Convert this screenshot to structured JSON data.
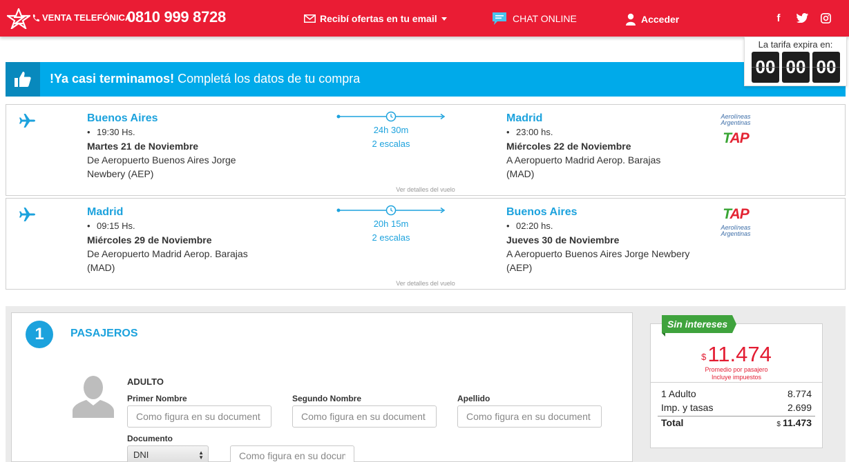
{
  "header": {
    "phone_label": "VENTA TELEFÓNICA",
    "phone_number": "0810 999 8728",
    "offers_label": "Recibí ofertas en tu email",
    "chat_label": "CHAT ONLINE",
    "login_label": "Acceder",
    "social_icons": [
      "facebook-icon",
      "twitter-icon",
      "instagram-icon"
    ],
    "brand_color": "#ea1c34"
  },
  "timer": {
    "label": "La tarifa expira en:",
    "hours": "00",
    "minutes": "00",
    "seconds": "00"
  },
  "banner": {
    "bold": "!Ya casi terminamos!",
    "text": " Completá los datos de tu compra",
    "color": "#00aaea"
  },
  "flights": [
    {
      "departure": {
        "city": "Buenos Aires",
        "time": "19:30 Hs.",
        "date": "Martes 21 de Noviembre",
        "airport": "De Aeropuerto Buenos Aires Jorge Newbery (AEP)"
      },
      "duration": "24h 30m",
      "stops": "2 escalas",
      "arrival": {
        "city": "Madrid",
        "time": "23:00 hs.",
        "date": "Miércoles 22 de Noviembre",
        "airport": "A Aeropuerto Madrid Aerop. Barajas (MAD)"
      },
      "details_link": "Ver detalles del vuelo",
      "airline_primary": "Aerolíneas Argentinas",
      "airline_secondary": "TAP"
    },
    {
      "departure": {
        "city": "Madrid",
        "time": "09:15 Hs.",
        "date": "Miércoles 29 de Noviembre",
        "airport": "De Aeropuerto Madrid Aerop. Barajas (MAD)"
      },
      "duration": "20h 15m",
      "stops": "2 escalas",
      "arrival": {
        "city": "Buenos Aires",
        "time": "02:20 hs.",
        "date": "Jueves 30 de Noviembre",
        "airport": "A Aeropuerto Buenos Aires Jorge Newbery (AEP)"
      },
      "details_link": "Ver detalles del vuelo",
      "airline_primary": "TAP",
      "airline_secondary": "Aerolíneas Argentinas"
    }
  ],
  "passengers": {
    "step_number": "1",
    "title": "PASAJEROS",
    "pax_type": "ADULTO",
    "first_name_label": "Primer Nombre",
    "second_name_label": "Segundo Nombre",
    "last_name_label": "Apellido",
    "document_label": "Documento",
    "placeholder": "Como figura en su document",
    "doc_placeholder": "Como figura en su documento",
    "document_type": "DNI"
  },
  "price": {
    "badge": "Sin intereses",
    "currency": "$",
    "amount": "11.474",
    "note_1": "Promedio por pasajero",
    "note_2": "Incluye impuestos",
    "rows": [
      {
        "label": "1 Adulto",
        "value": "8.774"
      },
      {
        "label": "Imp. y tasas",
        "value": "2.699"
      }
    ],
    "total_label": "Total",
    "total_currency": "$",
    "total_value": "11.473"
  }
}
